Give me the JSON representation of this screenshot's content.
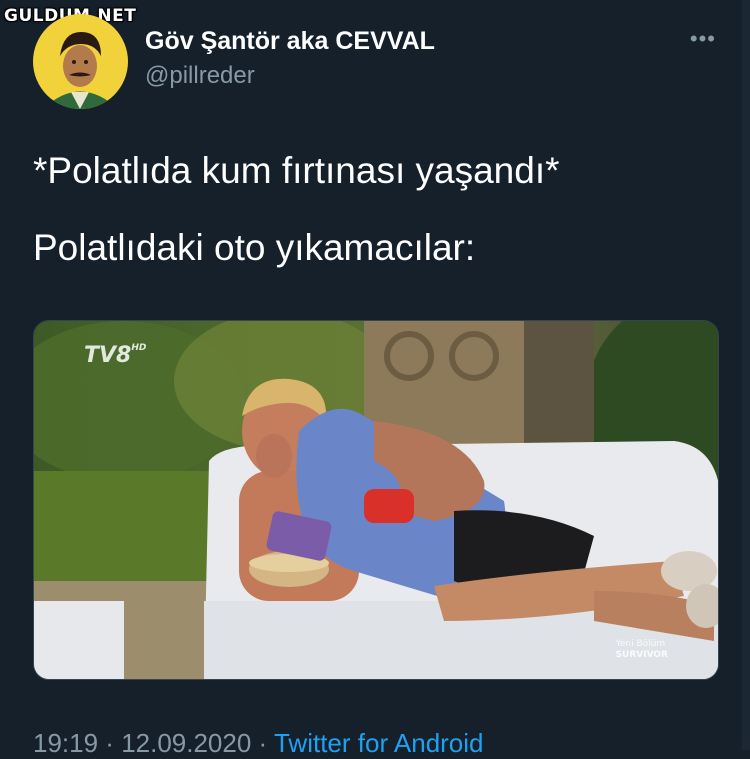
{
  "watermark": "GULDUM.NET",
  "user": {
    "display_name": "Göv Şantör aka CEVVAL",
    "handle": "@pillreder"
  },
  "more_icon": "more-horizontal-icon",
  "more_glyph": "•••",
  "tweet": {
    "line1": "*Polatlıda kum fırtınası yaşandı*",
    "line2": "Polatlıdaki oto yıkamacılar:"
  },
  "media": {
    "channel_logo": "TV8",
    "channel_logo_sub": "HD",
    "caption_line1": "Yeni Bölüm",
    "caption_line2": "SURVIVOR"
  },
  "meta": {
    "time": "19:19",
    "separator1": " · ",
    "date": "12.09.2020",
    "separator2": " · ",
    "source": "Twitter for Android"
  },
  "colors": {
    "background": "#15202b",
    "secondary_text": "#8899a6",
    "link": "#1da1f2"
  }
}
